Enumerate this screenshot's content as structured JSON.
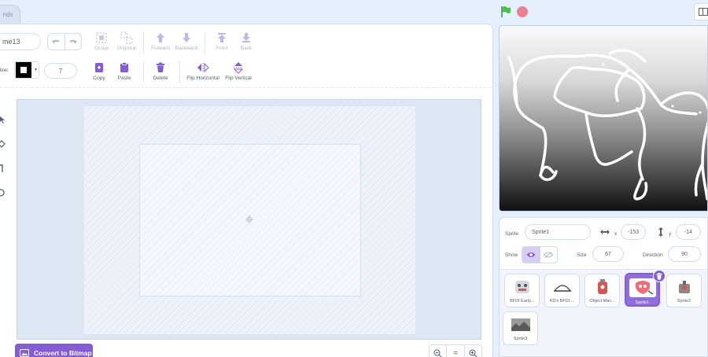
{
  "tabs": {
    "sounds_partial": "nds"
  },
  "paint_editor": {
    "costume_name": "me13",
    "toolbar": {
      "group": "Group",
      "ungroup": "Ungroup",
      "forward": "Forward",
      "backward": "Backward",
      "front": "Front",
      "back": "Back",
      "copy": "Copy",
      "paste": "Paste",
      "delete": "Delete",
      "flip_horizontal": "Flip Horizontal",
      "flip_vertical": "Flip Vertical"
    },
    "outline_label": "tline",
    "outline_color": "#000000",
    "stroke_width": "7",
    "convert_label": "Convert to Bitmap",
    "zoom": {
      "out": "−",
      "reset": "=",
      "in": "+"
    }
  },
  "controls": {
    "flag_color": "#0fbd8c",
    "stop_color": "#ec5c6c"
  },
  "sprite_info": {
    "sprite_label": "Sprite",
    "sprite_name": "Sprite1",
    "x_label": "x",
    "x_value": "-153",
    "y_label": "y",
    "y_value": "-14",
    "show_label": "Show",
    "size_label": "Size",
    "size_value": "67",
    "direction_label": "Direction",
    "direction_value": "90"
  },
  "sprites": [
    {
      "name": "BFDI Early...",
      "icon": "early-sprite-icon",
      "selected": false
    },
    {
      "name": "KD's BFDI ...",
      "icon": "dome-sprite-icon",
      "selected": false
    },
    {
      "name": "Object Mac...",
      "icon": "machine-sprite-icon",
      "selected": false
    },
    {
      "name": "Sprite1",
      "icon": "red-character-icon",
      "selected": true
    },
    {
      "name": "Sprite2",
      "icon": "robot-sprite-icon",
      "selected": false
    },
    {
      "name": "Sprite3",
      "icon": "photo-sprite-icon",
      "selected": false
    }
  ],
  "theme": {
    "accent": "#855cd6",
    "ink": "#575e75"
  }
}
